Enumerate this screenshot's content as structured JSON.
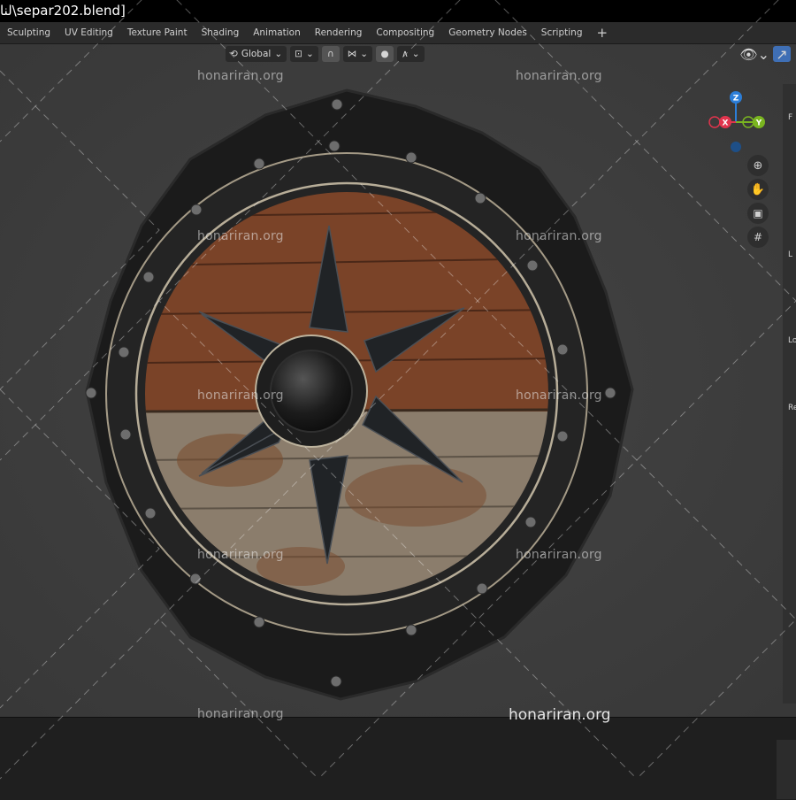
{
  "titlebar": {
    "text": "لنا\\separ202.blend]"
  },
  "workspace_tabs": [
    "Sculpting",
    "UV Editing",
    "Texture Paint",
    "Shading",
    "Animation",
    "Rendering",
    "Compositing",
    "Geometry Nodes",
    "Scripting"
  ],
  "tab_add": "+",
  "header": {
    "orientation": "Global"
  },
  "gizmo": {
    "z": "Z",
    "x": "X",
    "y": "Y"
  },
  "npanel_tabs": [
    "F",
    "L",
    "Lo",
    "Re"
  ],
  "watermark": "honariran.org",
  "watermark_big": "honariran.org",
  "icons": [
    "transform-pivot-icon",
    "snap-icon",
    "proportional-edit-icon",
    "view-object-icon",
    "gizmo-toggle-icon",
    "zoom-icon",
    "hand-pan-icon",
    "camera-icon",
    "grid-ortho-icon"
  ],
  "colors": {
    "viewport": "#3d3d3d",
    "wood_top": "#7a4328",
    "wood_bottom": "#8b7d6c",
    "metal": "#1f1f1f",
    "gizmo_x": "#e0344d",
    "gizmo_y": "#7ab520",
    "gizmo_z": "#2c7ed8"
  }
}
